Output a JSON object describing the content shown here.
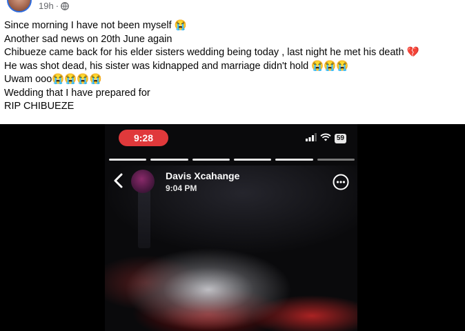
{
  "header": {
    "timestamp": "19h",
    "separator": "·",
    "privacy_icon": "globe-icon"
  },
  "post": {
    "lines": [
      "Since morning I have not been myself 😭",
      "Another sad news on 20th June again",
      "Chibueze came back for his elder sisters wedding being today , last night  he met his death 💔",
      "He was shot dead, his sister was kidnapped and marriage didn't hold 😭😭😭",
      "Uwam ooo😭😭😭😭",
      "Wedding that I have prepared for",
      "RIP CHIBUEZE"
    ]
  },
  "media": {
    "status_bar": {
      "time": "9:28",
      "battery": "59",
      "icons": [
        "signal-icon",
        "wifi-icon",
        "battery-icon"
      ]
    },
    "story_bars": {
      "count": 6,
      "active_count": 5
    },
    "story": {
      "name": "Davis  Xcahange",
      "time": "9:04 PM",
      "icons": [
        "back-chevron-icon",
        "more-options-icon"
      ]
    },
    "colors": {
      "time_pill": "#e0393b",
      "accent_ring": "#2d6cdf"
    }
  }
}
